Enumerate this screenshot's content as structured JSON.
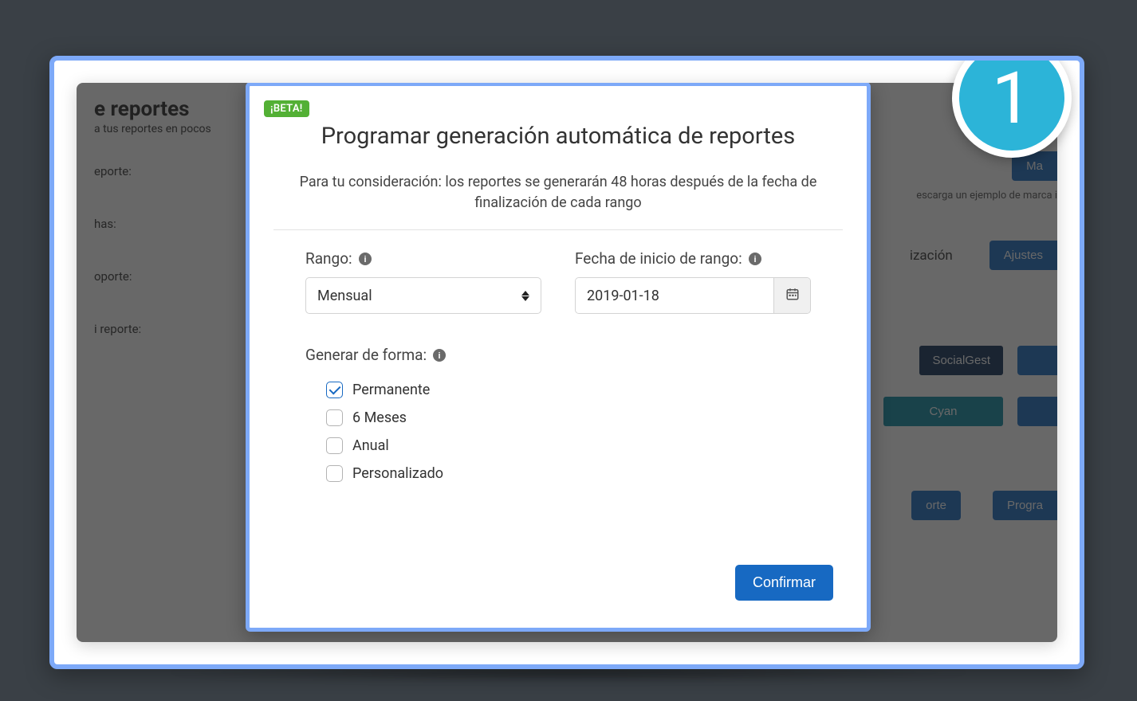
{
  "badge_number": "1",
  "page": {
    "title_partial": "e reportes",
    "subtitle_partial": "a tus reportes en pocos",
    "labels": [
      "eporte:",
      "has:",
      "oporte:",
      "i reporte:"
    ],
    "right_link": "escarga un ejemplo de marca i",
    "right_row3_text": "ización",
    "btn_manage": "Ma",
    "btn_settings": "Ajustes",
    "btn_socialgest": "SocialGest",
    "btn_cyan": "Cyan",
    "btn_action1": "orte",
    "btn_action2": "Progra"
  },
  "modal": {
    "beta": "¡BETA!",
    "title": "Programar generación automática de reportes",
    "subtitle": "Para tu consideración: los reportes se generarán 48 horas después de la fecha de finalización de cada rango",
    "range_label": "Rango:",
    "range_value": "Mensual",
    "date_label": "Fecha de inicio de rango:",
    "date_value": "2019-01-18",
    "generate_label": "Generar de forma:",
    "options": [
      {
        "label": "Permanente",
        "checked": true
      },
      {
        "label": "6 Meses",
        "checked": false
      },
      {
        "label": "Anual",
        "checked": false
      },
      {
        "label": "Personalizado",
        "checked": false
      }
    ],
    "confirm": "Confirmar"
  }
}
